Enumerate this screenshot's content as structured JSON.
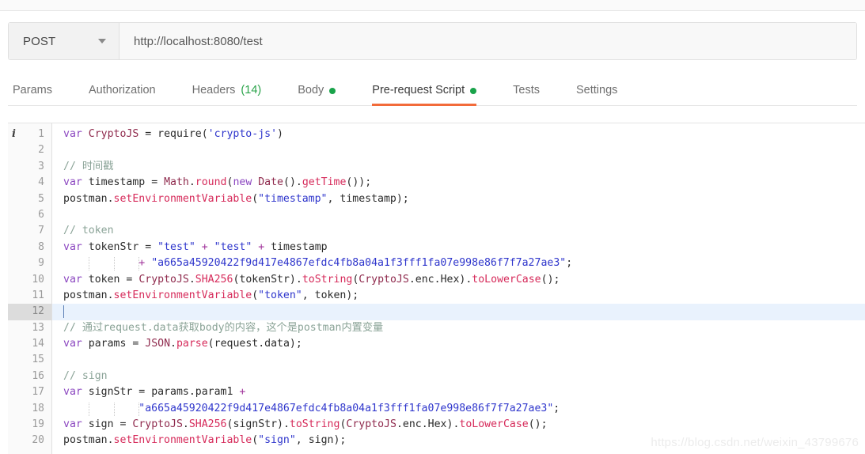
{
  "request_bar": {
    "method": "POST",
    "method_caret_icon": "chevron-down-icon",
    "url": "http://localhost:8080/test"
  },
  "tabs": [
    {
      "label": "Params",
      "count": "",
      "dot": false,
      "active": false
    },
    {
      "label": "Authorization",
      "count": "",
      "dot": false,
      "active": false
    },
    {
      "label": "Headers",
      "count": "(14)",
      "dot": false,
      "active": false
    },
    {
      "label": "Body",
      "count": "",
      "dot": true,
      "active": false
    },
    {
      "label": "Pre-request Script",
      "count": "",
      "dot": true,
      "active": true
    },
    {
      "label": "Tests",
      "count": "",
      "dot": false,
      "active": false
    },
    {
      "label": "Settings",
      "count": "",
      "dot": false,
      "active": false
    }
  ],
  "colors": {
    "accent_underline": "#f26b3a",
    "tab_dot_green": "#19a34a",
    "headers_count_green": "#2aa34a",
    "active_line_bg": "#e9f2fd",
    "active_gutter_bg": "#dcdcdc",
    "comment": "#8aa397",
    "string": "#2f36cc",
    "keyword": "#8b46c0",
    "function": "#d62a5a",
    "class": "#8f2a4d"
  },
  "editor": {
    "info_icon": "info-icon",
    "active_line": 12,
    "total_lines": 20,
    "line_numbers": [
      "1",
      "2",
      "3",
      "4",
      "5",
      "6",
      "7",
      "8",
      "9",
      "10",
      "11",
      "12",
      "13",
      "14",
      "15",
      "16",
      "17",
      "18",
      "19",
      "20"
    ],
    "lines": [
      "var CryptoJS = require('crypto-js')",
      "",
      "// 时间戳",
      "var timestamp = Math.round(new Date().getTime());",
      "postman.setEnvironmentVariable(\"timestamp\", timestamp);",
      "",
      "// token",
      "var tokenStr = \"test\" + \"test\" + timestamp",
      "            + \"a665a45920422f9d417e4867efdc4fb8a04a1f3fff1fa07e998e86f7f7a27ae3\";",
      "var token = CryptoJS.SHA256(tokenStr).toString(CryptoJS.enc.Hex).toLowerCase();",
      "postman.setEnvironmentVariable(\"token\", token);",
      "",
      "// 通过request.data获取body的内容，这个是postman内置变量",
      "var params = JSON.parse(request.data);",
      "",
      "// sign",
      "var signStr = params.param1 +",
      "            \"a665a45920422f9d417e4867efdc4fb8a04a1f3fff1fa07e998e86f7f7a27ae3\";",
      "var sign = CryptoJS.SHA256(signStr).toString(CryptoJS.enc.Hex).toLowerCase();",
      "postman.setEnvironmentVariable(\"sign\", sign);"
    ],
    "secret_hash": "a665a45920422f9d417e4867efdc4fb8a04a1f3fff1fa07e998e86f7f7a27ae3"
  },
  "watermark": "https://blog.csdn.net/weixin_43799676"
}
